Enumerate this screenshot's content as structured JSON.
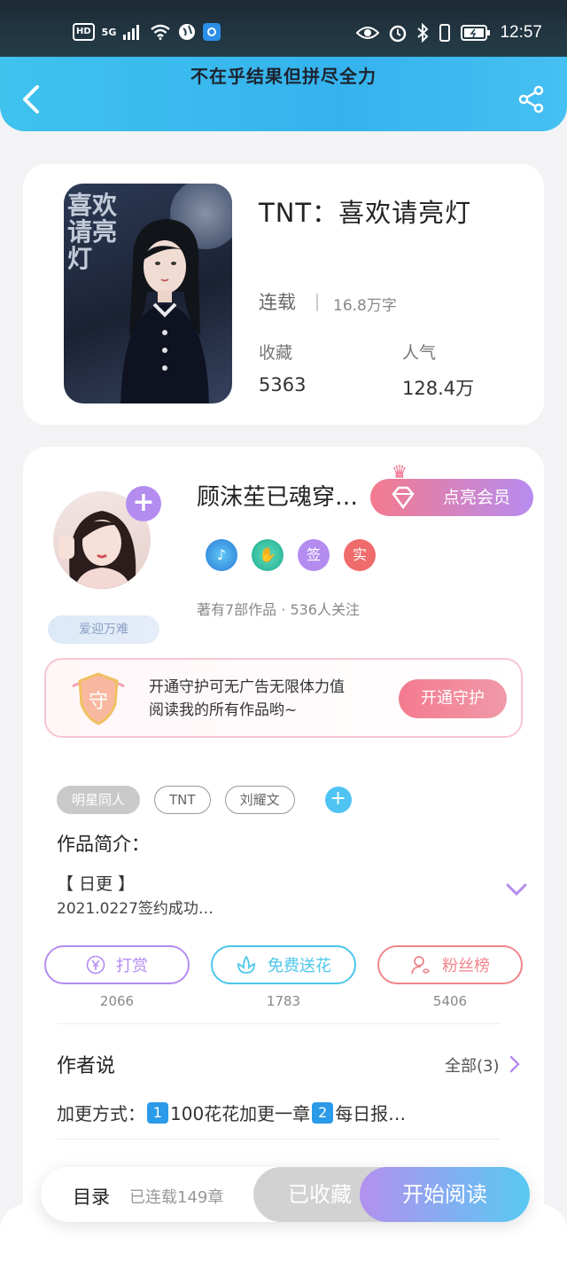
{
  "status_bar": {
    "hd": "HD",
    "network": "5G",
    "time": "12:57"
  },
  "header": {
    "title": "不在乎结果但拼尽全力"
  },
  "book": {
    "title": "TNT：喜欢请亮灯",
    "cover_text": "喜欢请亮灯",
    "status": "连载",
    "word_count": "16.8万字",
    "favorites_label": "收藏",
    "favorites_value": "5363",
    "popularity_label": "人气",
    "popularity_value": "128.4万"
  },
  "author": {
    "name": "顾沫苼已魂穿…",
    "tag": "爱迎万难",
    "vip_label": "点亮会员",
    "badges": [
      "签",
      "实"
    ],
    "meta": "著有7部作品 · 536人关注",
    "guard_icon_text": "守",
    "guard_text_line1": "开通守护可无广告无限体力值",
    "guard_text_line2": "阅读我的所有作品哟~",
    "guard_button": "开通守护"
  },
  "tags": [
    "明星同人",
    "TNT",
    "刘耀文"
  ],
  "intro": {
    "title": "作品简介：",
    "line1": "【 日更 】",
    "line2": "2021.0227签约成功…"
  },
  "actions": [
    {
      "label": "打赏",
      "count": "2066",
      "color": "#b48cf0"
    },
    {
      "label": "免费送花",
      "count": "1783",
      "color": "#4cc6ea"
    },
    {
      "label": "粉丝榜",
      "count": "5406",
      "color": "#f0868c"
    }
  ],
  "author_says": {
    "title": "作者说",
    "all_label": "全部(3)",
    "content_prefix": "加更方式：",
    "content_mid": "100花花加更一章",
    "content_suffix": "每日报…",
    "key1": "1",
    "key2": "2"
  },
  "bottom_bar": {
    "toc_label": "目录",
    "toc_count": "已连载149章",
    "collected_label": "已收藏",
    "read_label": "开始阅读"
  }
}
